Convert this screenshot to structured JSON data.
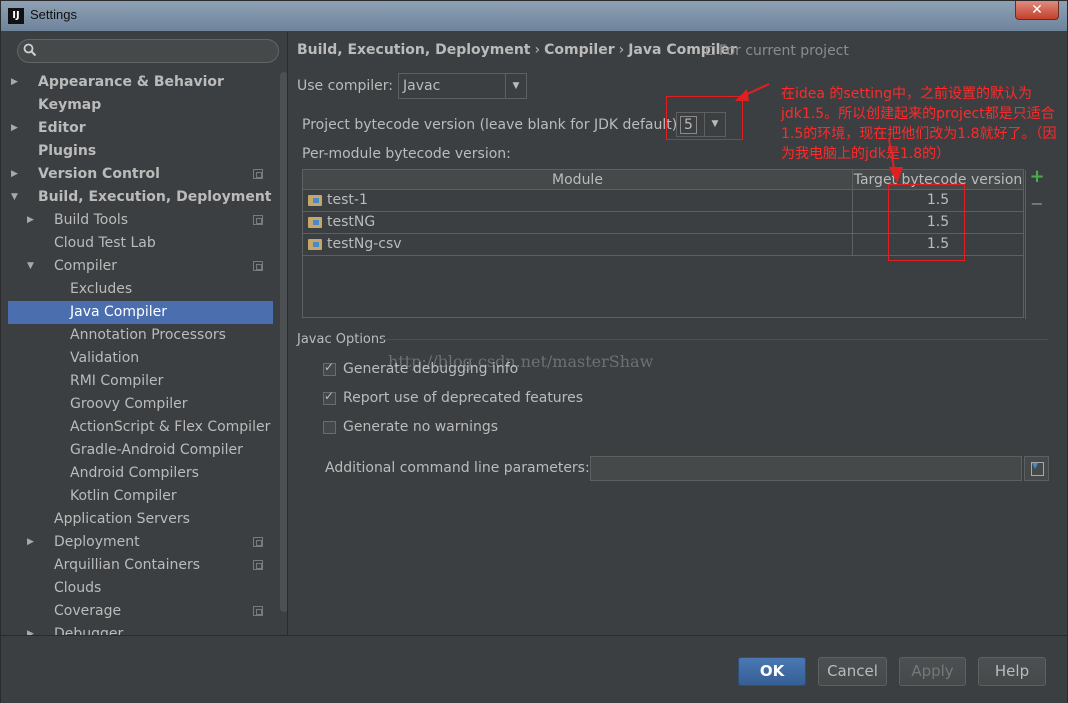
{
  "window": {
    "title": "Settings",
    "app_icon_text": "IJ"
  },
  "sidebar": {
    "search_placeholder": "",
    "items": [
      {
        "label": "Appearance & Behavior",
        "level": 0,
        "bold": true,
        "arrow": "right"
      },
      {
        "label": "Keymap",
        "level": 0,
        "bold": true
      },
      {
        "label": "Editor",
        "level": 0,
        "bold": true,
        "arrow": "right"
      },
      {
        "label": "Plugins",
        "level": 0,
        "bold": true
      },
      {
        "label": "Version Control",
        "level": 0,
        "bold": true,
        "arrow": "right",
        "project": true
      },
      {
        "label": "Build, Execution, Deployment",
        "level": 0,
        "bold": true,
        "arrow": "down"
      },
      {
        "label": "Build Tools",
        "level": 1,
        "arrow": "right",
        "project": true
      },
      {
        "label": "Cloud Test Lab",
        "level": 1
      },
      {
        "label": "Compiler",
        "level": 1,
        "arrow": "down",
        "project": true
      },
      {
        "label": "Excludes",
        "level": 2
      },
      {
        "label": "Java Compiler",
        "level": 2,
        "selected": true
      },
      {
        "label": "Annotation Processors",
        "level": 2
      },
      {
        "label": "Validation",
        "level": 2
      },
      {
        "label": "RMI Compiler",
        "level": 2
      },
      {
        "label": "Groovy Compiler",
        "level": 2
      },
      {
        "label": "ActionScript & Flex Compiler",
        "level": 2
      },
      {
        "label": "Gradle-Android Compiler",
        "level": 2
      },
      {
        "label": "Android Compilers",
        "level": 2
      },
      {
        "label": "Kotlin Compiler",
        "level": 2
      },
      {
        "label": "Application Servers",
        "level": 1
      },
      {
        "label": "Deployment",
        "level": 1,
        "arrow": "right",
        "project": true
      },
      {
        "label": "Arquillian Containers",
        "level": 1,
        "project": true
      },
      {
        "label": "Clouds",
        "level": 1
      },
      {
        "label": "Coverage",
        "level": 1,
        "project": true
      },
      {
        "label": "Debugger",
        "level": 1,
        "arrow": "right"
      }
    ]
  },
  "breadcrumb": {
    "parts": [
      "Build, Execution, Deployment",
      "Compiler",
      "Java Compiler"
    ],
    "separator": "›",
    "scope": "For current project"
  },
  "compiler": {
    "use_compiler_label": "Use compiler:",
    "use_compiler_value": "Javac",
    "bytecode_label": "Project bytecode version (leave blank for JDK default):",
    "bytecode_value": "5",
    "per_module_label": "Per-module bytecode version:"
  },
  "module_table": {
    "headers": [
      "Module",
      "Target bytecode version"
    ],
    "rows": [
      {
        "module": "test-1",
        "target": "1.5"
      },
      {
        "module": "testNG",
        "target": "1.5"
      },
      {
        "module": "testNg-csv",
        "target": "1.5"
      }
    ],
    "add_label": "+",
    "remove_label": "−"
  },
  "javac_options": {
    "section_title": "Javac Options",
    "options": [
      {
        "label": "Generate debugging info",
        "checked": true
      },
      {
        "label": "Report use of deprecated features",
        "checked": true
      },
      {
        "label": "Generate no warnings",
        "checked": false
      }
    ],
    "additional_label": "Additional command line parameters:",
    "additional_value": ""
  },
  "watermark": "http://blog.csdn.net/masterShaw",
  "annotation": {
    "text": "在idea 的setting中，之前设置的默认为jdk1.5。所以创建起来的project都是只适合1.5的环境，现在把他们改为1.8就好了。（因为我电脑上的jdk是1.8的）",
    "color": "#ff2a2a"
  },
  "buttons": {
    "ok": "OK",
    "cancel": "Cancel",
    "apply": "Apply",
    "help": "Help"
  },
  "colors": {
    "selection": "#4b6eaf",
    "background": "#3c3f41",
    "text": "#bbbbbb",
    "primary_button": "#4a78b4"
  }
}
